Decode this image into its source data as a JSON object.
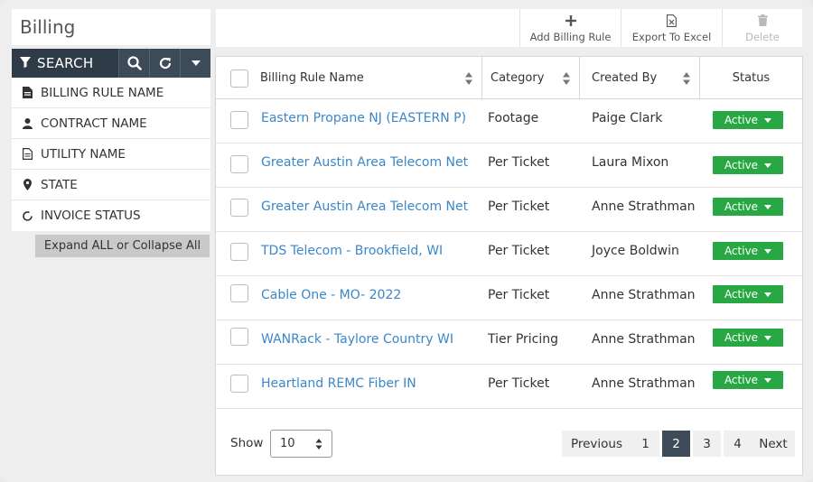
{
  "page": {
    "title": "Billing"
  },
  "search": {
    "label": "SEARCH",
    "filters": [
      {
        "label": "BILLING RULE NAME",
        "icon": "document-icon"
      },
      {
        "label": "CONTRACT NAME",
        "icon": "user-icon"
      },
      {
        "label": "UTILITY NAME",
        "icon": "document-outline-icon"
      },
      {
        "label": "STATE",
        "icon": "map-pin-icon"
      },
      {
        "label": "INVOICE STATUS",
        "icon": "circle-refresh-icon"
      }
    ],
    "expand_label": "Expand ALL or Collapse All"
  },
  "toolbar": {
    "add_label": "Add Billing Rule",
    "export_label": "Export To Excel",
    "delete_label": "Delete"
  },
  "table": {
    "columns": [
      "Billing Rule Name",
      "Category",
      "Created By",
      "Status"
    ],
    "rows": [
      {
        "name": "Eastern Propane NJ (EASTERN P)",
        "category": "Footage",
        "created_by": "Paige Clark",
        "status": "Active"
      },
      {
        "name": "Greater Austin Area Telecom Net",
        "category": "Per Ticket",
        "created_by": "Laura Mixon",
        "status": "Active"
      },
      {
        "name": "Greater Austin Area Telecom Net",
        "category": "Per Ticket",
        "created_by": "Anne Strathman",
        "status": "Active"
      },
      {
        "name": "TDS Telecom - Brookfield, WI",
        "category": "Per Ticket",
        "created_by": "Joyce Boldwin",
        "status": "Active"
      },
      {
        "name": "Cable One - MO- 2022",
        "category": "Per Ticket",
        "created_by": "Anne Strathman",
        "status": "Active"
      },
      {
        "name": "WANRack - Taylore Country WI",
        "category": "Tier Pricing",
        "created_by": "Anne Strathman",
        "status": "Active"
      },
      {
        "name": "Heartland REMC Fiber IN",
        "category": "Per Ticket",
        "created_by": "Anne Strathman",
        "status": "Active"
      }
    ]
  },
  "footer": {
    "show_label": "Show",
    "page_size": "10",
    "previous_label": "Previous",
    "pages": [
      "1",
      "2",
      "3",
      "4"
    ],
    "current_page": "2",
    "next_label": "Next"
  },
  "colors": {
    "accent": "#3d4a57",
    "status_active": "#28a745",
    "link": "#3b87c9"
  }
}
